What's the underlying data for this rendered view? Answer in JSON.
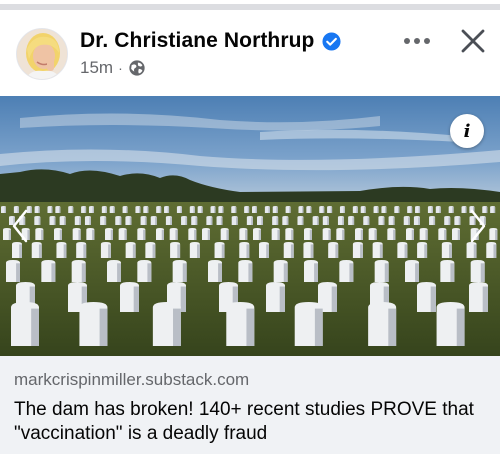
{
  "post": {
    "author_name": "Dr. Christiane Northrup",
    "timestamp": "15m",
    "separator": "·",
    "privacy_icon": "globe-icon",
    "verified_icon": "verified-badge-icon",
    "more_icon": "more-dots-icon",
    "close_icon": "close-icon"
  },
  "media": {
    "info_label": "i",
    "prev_icon": "chevron-left-icon",
    "next_icon": "chevron-right-icon"
  },
  "link_preview": {
    "domain": "markcrispinmiller.substack.com",
    "headline": "The dam has broken! 140+ recent studies PROVE that \"vaccination\" is a deadly fraud"
  },
  "colors": {
    "verified_blue": "#1877f2",
    "secondary_text": "#65676b",
    "link_background": "#f0f2f5"
  }
}
